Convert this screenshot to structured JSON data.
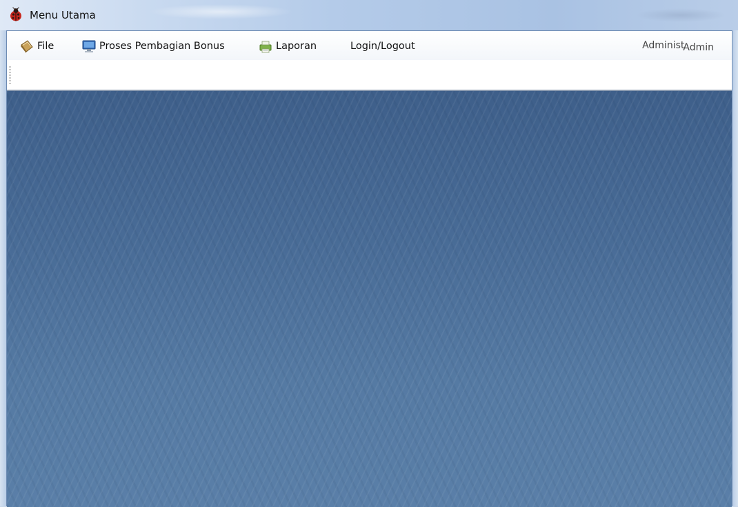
{
  "window": {
    "title": "Menu Utama",
    "app_icon": "ladybug-icon"
  },
  "menubar": {
    "items": [
      {
        "label": "File",
        "icon": "book-icon"
      },
      {
        "label": "Proses Pembagian Bonus",
        "icon": "monitor-icon"
      },
      {
        "label": "Laporan",
        "icon": "printer-icon"
      },
      {
        "label": "Login/Logout",
        "icon": ""
      }
    ],
    "status": {
      "role": "Administ",
      "user": "Admin"
    }
  },
  "colors": {
    "desktop_top": "#3e5f8a",
    "desktop_bottom": "#5a7fa8",
    "titlebar": "#b4cbe9"
  }
}
